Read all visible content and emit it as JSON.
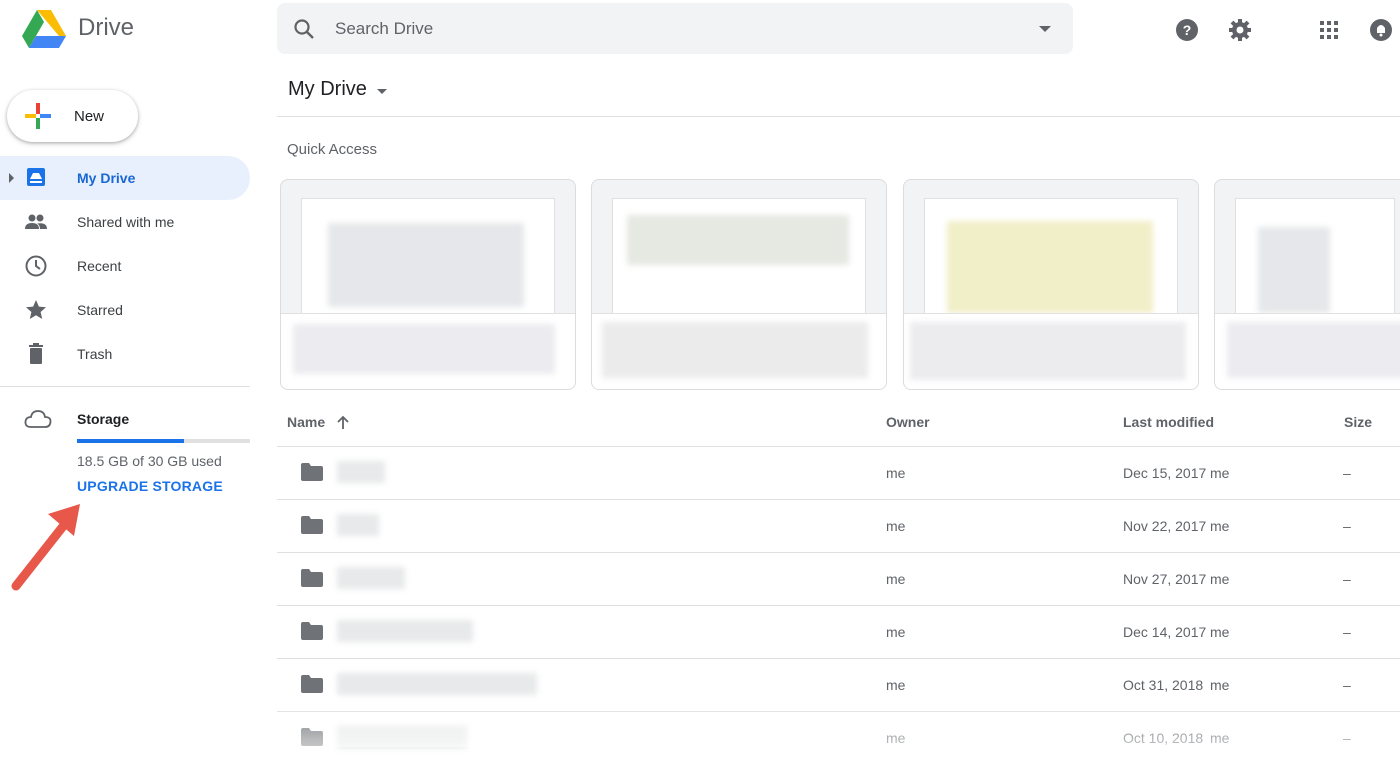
{
  "app": {
    "brand": "Drive"
  },
  "search": {
    "placeholder": "Search Drive"
  },
  "header_icons": [
    "help-icon",
    "settings-icon",
    "apps-grid-icon",
    "notifications-icon"
  ],
  "sidebar": {
    "new_label": "New",
    "items": [
      {
        "label": "My Drive",
        "icon": "my-drive-icon",
        "active": true
      },
      {
        "label": "Shared with me",
        "icon": "shared-icon",
        "active": false
      },
      {
        "label": "Recent",
        "icon": "clock-icon",
        "active": false
      },
      {
        "label": "Starred",
        "icon": "star-icon",
        "active": false
      },
      {
        "label": "Trash",
        "icon": "trash-icon",
        "active": false
      }
    ],
    "storage": {
      "label": "Storage",
      "used_text": "18.5 GB of 30 GB used",
      "used_fraction": 0.617,
      "upgrade_label": "UPGRADE STORAGE"
    }
  },
  "main": {
    "title": "My Drive",
    "quick_access_label": "Quick Access",
    "columns": {
      "name": "Name",
      "owner": "Owner",
      "modified": "Last modified",
      "size": "Size"
    },
    "rows": [
      {
        "owner": "me",
        "modified": "Dec 15, 2017",
        "modified_by": "me",
        "size": "–"
      },
      {
        "owner": "me",
        "modified": "Nov 22, 2017",
        "modified_by": "me",
        "size": "–"
      },
      {
        "owner": "me",
        "modified": "Nov 27, 2017",
        "modified_by": "me",
        "size": "–"
      },
      {
        "owner": "me",
        "modified": "Dec 14, 2017",
        "modified_by": "me",
        "size": "–"
      },
      {
        "owner": "me",
        "modified": "Oct 31, 2018",
        "modified_by": "me",
        "size": "–"
      },
      {
        "owner": "me",
        "modified": "Oct 10, 2018",
        "modified_by": "me",
        "size": "–"
      }
    ]
  },
  "colors": {
    "accent": "#1a73e8",
    "active_bg": "#e8f0fe",
    "annotation_arrow": "#e8584a"
  }
}
